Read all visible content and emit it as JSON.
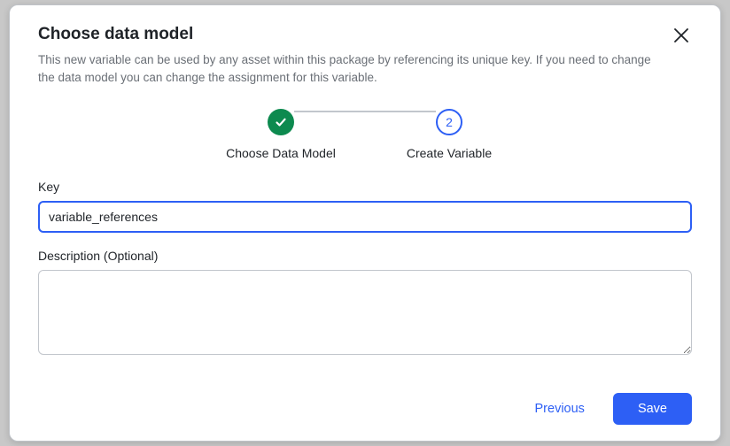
{
  "modal": {
    "title": "Choose data model",
    "subtitle": "This new variable can be used by any asset within this package by referencing its unique key. If you need to change the data model you can change the assignment for this variable."
  },
  "stepper": {
    "steps": [
      {
        "label": "Choose Data Model",
        "state": "done"
      },
      {
        "label": "Create Variable",
        "state": "current",
        "number": "2"
      }
    ]
  },
  "form": {
    "key": {
      "label": "Key",
      "value": "variable_references"
    },
    "description": {
      "label": "Description (Optional)",
      "value": ""
    }
  },
  "footer": {
    "previous": "Previous",
    "save": "Save"
  }
}
